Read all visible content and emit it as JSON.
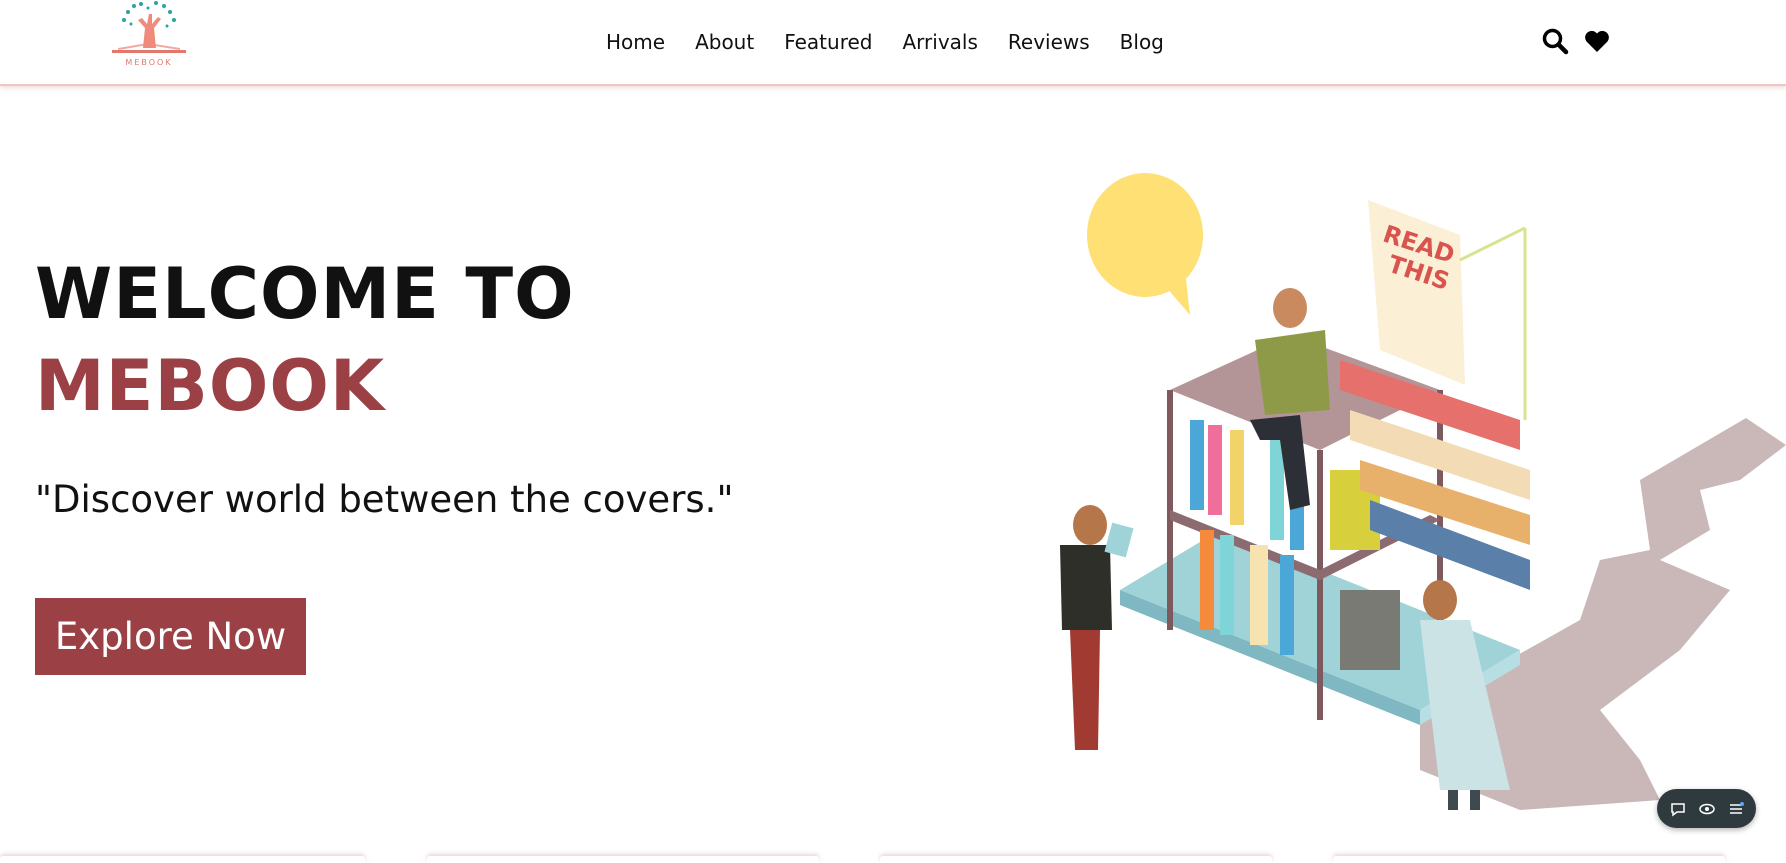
{
  "header": {
    "logo_text": "MEBOOK",
    "nav": [
      "Home",
      "About",
      "Featured",
      "Arrivals",
      "Reviews",
      "Blog"
    ],
    "icons": [
      "search-icon",
      "heart-icon"
    ]
  },
  "hero": {
    "title_line1": "WELCOME TO",
    "title_line2": "MEBOOK",
    "tagline": "\"Discover world between the covers.\"",
    "cta_label": "Explore Now",
    "illustration_sign": "READ THIS"
  },
  "widget": {
    "icons": [
      "chat-icon",
      "eye-icon",
      "menu-icon"
    ]
  },
  "colors": {
    "brand": "#9b4045",
    "text": "#111111",
    "header_border": "#f2c4c4",
    "widget_bg": "#2f3a3f"
  }
}
